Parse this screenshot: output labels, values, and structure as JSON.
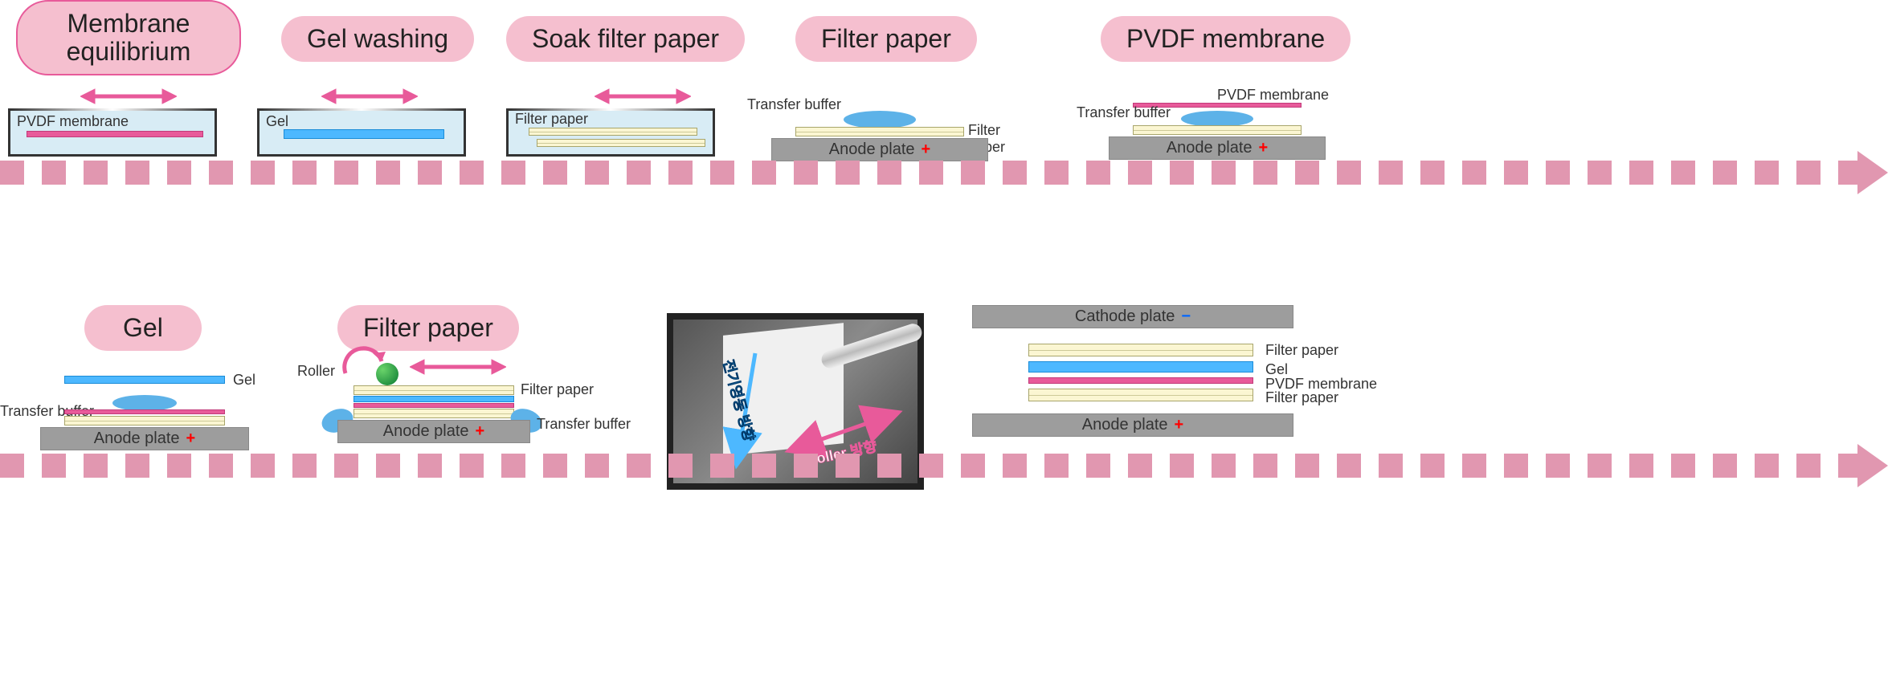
{
  "steps": {
    "s1": "Membrane\nequilibrium",
    "s2": "Gel washing",
    "s3": "Soak filter paper",
    "s4": "Filter paper",
    "s5": "PVDF membrane",
    "s6": "Gel",
    "s7": "Filter paper"
  },
  "labels": {
    "pvdf_membrane": "PVDF membrane",
    "gel": "Gel",
    "filter_paper": "Filter paper",
    "transfer_buffer": "Transfer buffer",
    "anode_plate": "Anode plate",
    "cathode_plate": "Cathode plate",
    "plus": "+",
    "minus": "−",
    "roller": "Roller"
  },
  "photo": {
    "arrow1": "전기영동 방향",
    "arrow2": "Roller 방향"
  },
  "stack": {
    "top": "Filter paper",
    "gel": "Gel",
    "pvdf": "PVDF membrane",
    "bottom": "Filter paper"
  }
}
